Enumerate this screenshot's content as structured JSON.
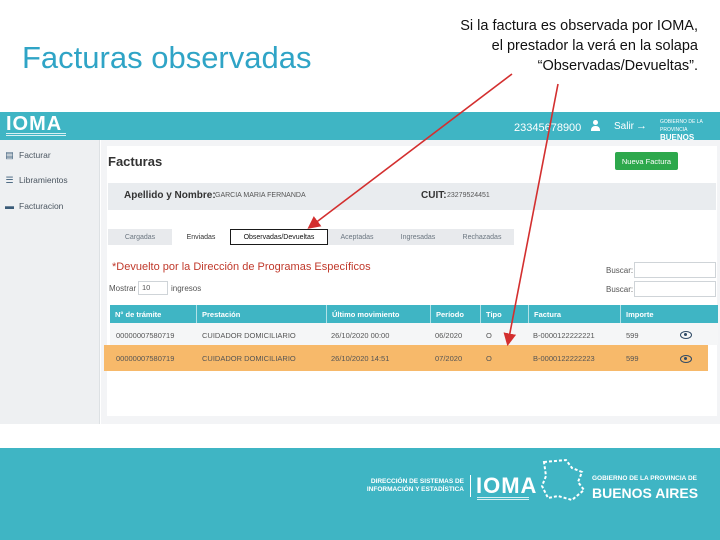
{
  "slide": {
    "title": "Facturas observadas",
    "note_lines": [
      "Si la factura es observada por IOMA,",
      "el prestador la verá en la solapa",
      "“Observadas/Devueltas”."
    ]
  },
  "topbar": {
    "logo": "IOMA",
    "user_id": "23345678900",
    "logout_label": "Salir",
    "logout_icon": "→",
    "gov_logo_line1": "GOBIERNO DE LA PROVINCIA",
    "gov_logo_line2": "BUENOS AIRES"
  },
  "sidebar": {
    "items": [
      {
        "label": "Facturar",
        "icon": "document-icon",
        "glyph": "▤"
      },
      {
        "label": "Libramientos",
        "icon": "list-icon",
        "glyph": "☰"
      },
      {
        "label": "Facturacion",
        "icon": "folder-icon",
        "glyph": "▬"
      }
    ]
  },
  "main": {
    "title": "Facturas",
    "new_button": "Nueva Factura",
    "name_label": "Apellido y Nombre:",
    "name_value": "GARCIA MARIA FERNANDA",
    "cuit_label": "CUIT:",
    "cuit_value": "23279524451",
    "tabs": [
      "Cargadas",
      "Enviadas",
      "Observadas/Devueltas",
      "Aceptadas",
      "Ingresadas",
      "Rechazadas"
    ],
    "filter_note": "*Devuelto por la Dirección de Programas Específicos",
    "search_label": "Buscar:",
    "show_label": "Mostrar",
    "show_value": "10",
    "entries_label": "ingresos"
  },
  "table": {
    "headers": [
      "N° de trámite",
      "Prestación",
      "Último movimiento",
      "Período",
      "Tipo",
      "Factura",
      "Importe"
    ],
    "rows": [
      [
        "00000007580719",
        "CUIDADOR DOMICILIARIO",
        "26/10/2020 00:00",
        "06/2020",
        "O",
        "B-0000122222221",
        "599"
      ],
      [
        "00000007580719",
        "CUIDADOR DOMICILIARIO",
        "26/10/2020 14:51",
        "07/2020",
        "O",
        "B-0000122222223",
        "599"
      ]
    ]
  },
  "footer": {
    "dir_line1": "DIRECCIÓN DE SISTEMAS DE",
    "dir_line2": "INFORMACIÓN Y ESTADÍSTICA",
    "logo": "IOMA",
    "gov_line1": "GOBIERNO DE LA PROVINCIA DE",
    "gov_line2": "BUENOS AIRES"
  },
  "colors": {
    "brand": "#3fb5c4",
    "title": "#2fa4c6",
    "highlight_row": "#f7b96a",
    "button_green": "#2da84c",
    "arrow": "#d32f2f"
  }
}
